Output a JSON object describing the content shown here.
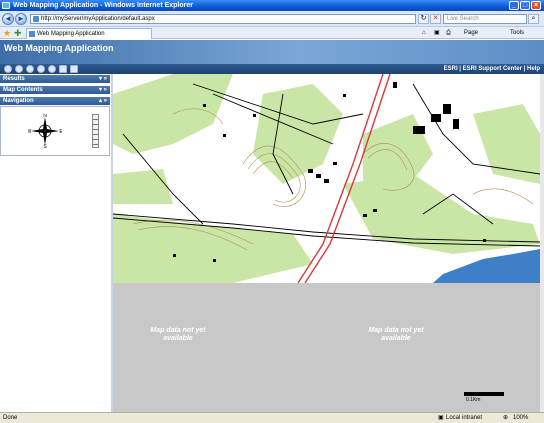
{
  "window": {
    "title": "Web Mapping Application - Windows Internet Explorer",
    "buttons": {
      "minimize": "_",
      "maximize": "□",
      "close": "×"
    }
  },
  "browser": {
    "back": "◄",
    "forward": "►",
    "address": "http://myServer/myApplication/default.aspx",
    "search_placeholder": "Live Search",
    "tab_label": "Web Mapping Application",
    "commands": {
      "page": "Page",
      "tools": "Tools"
    }
  },
  "app": {
    "title": "Web Mapping Application",
    "links": "ESRI | ESRI Support Center | Help",
    "panels": [
      {
        "label": "Results",
        "controls": "▾ »"
      },
      {
        "label": "Map Contents",
        "controls": "▾ »"
      },
      {
        "label": "Navigation",
        "controls": "▴ »"
      }
    ],
    "compass": {
      "n": "N",
      "s": "S",
      "e": "E",
      "w": "W"
    },
    "map": {
      "nodata_1": "Map data not yet available",
      "nodata_2": "Map data not yet available",
      "scale_label": "0.1Km",
      "colors": {
        "vegetation": "#c9e6a7",
        "water": "#3f7fc7",
        "highway": "#d83a3a",
        "contour": "#b58a4b"
      }
    }
  },
  "status": {
    "left": "Done",
    "zone": "Local intranet",
    "zoom": "100%"
  }
}
